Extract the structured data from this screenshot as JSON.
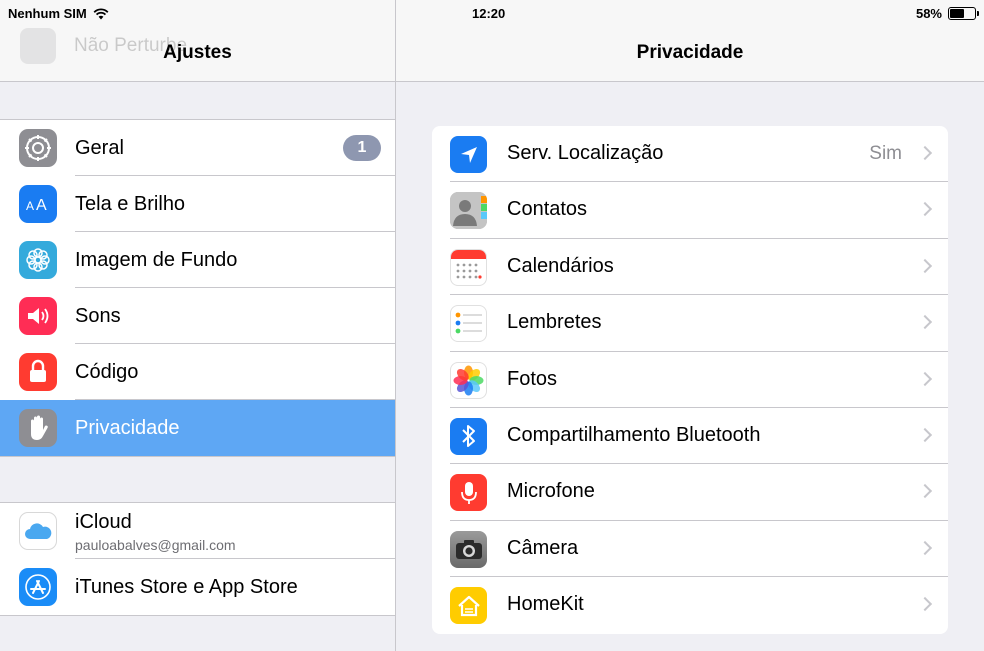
{
  "status_bar": {
    "carrier": "Nenhum SIM",
    "time": "12:20",
    "battery_percent": "58%",
    "battery_level": 0.58
  },
  "left_pane": {
    "ghost_item": "Não Perturbe",
    "title": "Ajustes",
    "group1": [
      {
        "label": "Geral",
        "icon": "gear-icon",
        "color": "#8e8e93",
        "badge": "1"
      },
      {
        "label": "Tela e Brilho",
        "icon": "text-size-icon",
        "color": "#1a7cf2"
      },
      {
        "label": "Imagem de Fundo",
        "icon": "flower-icon",
        "color": "#34aadc"
      },
      {
        "label": "Sons",
        "icon": "speaker-icon",
        "color": "#ff2d55"
      },
      {
        "label": "Código",
        "icon": "lock-icon",
        "color": "#ff3b30"
      },
      {
        "label": "Privacidade",
        "icon": "hand-icon",
        "color": "#8e8e93",
        "selected": true
      }
    ],
    "group2": [
      {
        "label": "iCloud",
        "sub": "pauloabalves@gmail.com",
        "icon": "cloud-icon",
        "color": "#ffffff"
      },
      {
        "label": "iTunes Store e App Store",
        "icon": "app-store-icon",
        "color": "#1a8cf7"
      }
    ]
  },
  "right_pane": {
    "title": "Privacidade",
    "items": [
      {
        "label": "Serv. Localização",
        "value": "Sim",
        "icon": "location-arrow-icon",
        "color": "#1a7cf2"
      },
      {
        "label": "Contatos",
        "icon": "contacts-icon",
        "color": "#b8b8b8"
      },
      {
        "label": "Calendários",
        "icon": "calendar-icon",
        "color": "#ffffff"
      },
      {
        "label": "Lembretes",
        "icon": "reminders-icon",
        "color": "#ffffff"
      },
      {
        "label": "Fotos",
        "icon": "photos-icon",
        "color": "#ffffff"
      },
      {
        "label": "Compartilhamento Bluetooth",
        "icon": "bluetooth-icon",
        "color": "#1a7cf2"
      },
      {
        "label": "Microfone",
        "icon": "microphone-icon",
        "color": "#ff3b30"
      },
      {
        "label": "Câmera",
        "icon": "camera-icon",
        "color": "#7a7a7a"
      },
      {
        "label": "HomeKit",
        "icon": "home-icon",
        "color": "#ffcc00"
      }
    ]
  },
  "colors": {
    "selection": "#5ea7f4",
    "separator": "#c8c7cc",
    "background": "#efeff4"
  }
}
